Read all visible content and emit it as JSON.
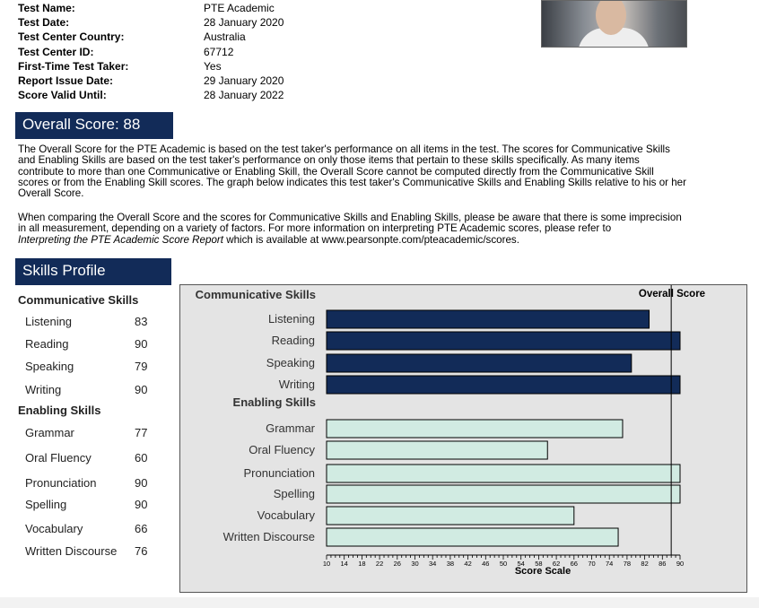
{
  "test_info": [
    {
      "label": "Test Name:",
      "value": "PTE Academic"
    },
    {
      "label": "Test Date:",
      "value": "28 January 2020"
    },
    {
      "label": "Test Center Country:",
      "value": "Australia"
    },
    {
      "label": "Test Center ID:",
      "value": "67712"
    },
    {
      "label": "First-Time Test Taker:",
      "value": "Yes"
    },
    {
      "label": "Report Issue Date:",
      "value": "29 January 2020"
    },
    {
      "label": "Score Valid Until:",
      "value": "28 January 2022"
    }
  ],
  "overall": {
    "banner": "Overall Score:  88"
  },
  "paragraph1": "The Overall Score for the PTE Academic is based on the test taker's performance on all items in the test.  The scores for Communicative Skills and Enabling Skills are based on the test taker's performance on only those items that pertain to these skills specifically.  As many items contribute to more than one Communicative or Enabling Skill, the Overall Score cannot be computed directly from the Communicative Skill scores or from the Enabling Skill scores.  The graph below indicates this test taker's Communicative Skills and Enabling Skills relative to his or her Overall Score.",
  "paragraph2": {
    "text": "When comparing the Overall Score and the scores for Communicative Skills and Enabling Skills, please be aware that there is some imprecision in all measurement, depending on a variety of factors.  For more information on interpreting PTE Academic scores, please refer to",
    "italic": "Interpreting the PTE Academic Score Report",
    "tail": " which is available at www.pearsonpte.com/pteacademic/scores."
  },
  "skills_profile": {
    "banner": "Skills Profile"
  },
  "left_list": {
    "communicative_title": "Communicative Skills",
    "communicative": [
      {
        "label": "Listening",
        "score": "83"
      },
      {
        "label": "Reading",
        "score": "90"
      },
      {
        "label": "Speaking",
        "score": "79"
      },
      {
        "label": "Writing",
        "score": "90"
      }
    ],
    "enabling_title": "Enabling Skills",
    "enabling": [
      {
        "label": "Grammar",
        "score": "77"
      },
      {
        "label": "Oral Fluency",
        "score": "60"
      },
      {
        "label": "Pronunciation",
        "score": "90"
      },
      {
        "label": "Spelling",
        "score": "90"
      },
      {
        "label": "Vocabulary",
        "score": "66"
      },
      {
        "label": "Written Discourse",
        "score": "76"
      }
    ]
  },
  "chart_data": {
    "type": "bar",
    "orientation": "horizontal",
    "groups": [
      {
        "name": "Communicative Skills",
        "color": "#122b58",
        "categories": [
          "Listening",
          "Reading",
          "Speaking",
          "Writing"
        ],
        "values": [
          83,
          90,
          79,
          90
        ]
      },
      {
        "name": "Enabling Skills",
        "color": "#d1ebe2",
        "categories": [
          "Grammar",
          "Oral Fluency",
          "Pronunciation",
          "Spelling",
          "Vocabulary",
          "Written Discourse"
        ],
        "values": [
          77,
          60,
          90,
          90,
          66,
          76
        ]
      }
    ],
    "reference_line": {
      "label": "Overall Score",
      "value": 88
    },
    "xlabel": "Score Scale",
    "xlim": [
      10,
      90
    ],
    "xticks": [
      "10",
      "14",
      "18",
      "22",
      "26",
      "30",
      "34",
      "38",
      "42",
      "46",
      "50",
      "54",
      "58",
      "62",
      "66",
      "70",
      "74",
      "78",
      "82",
      "86",
      "90"
    ],
    "background": "#e4e4e4"
  }
}
